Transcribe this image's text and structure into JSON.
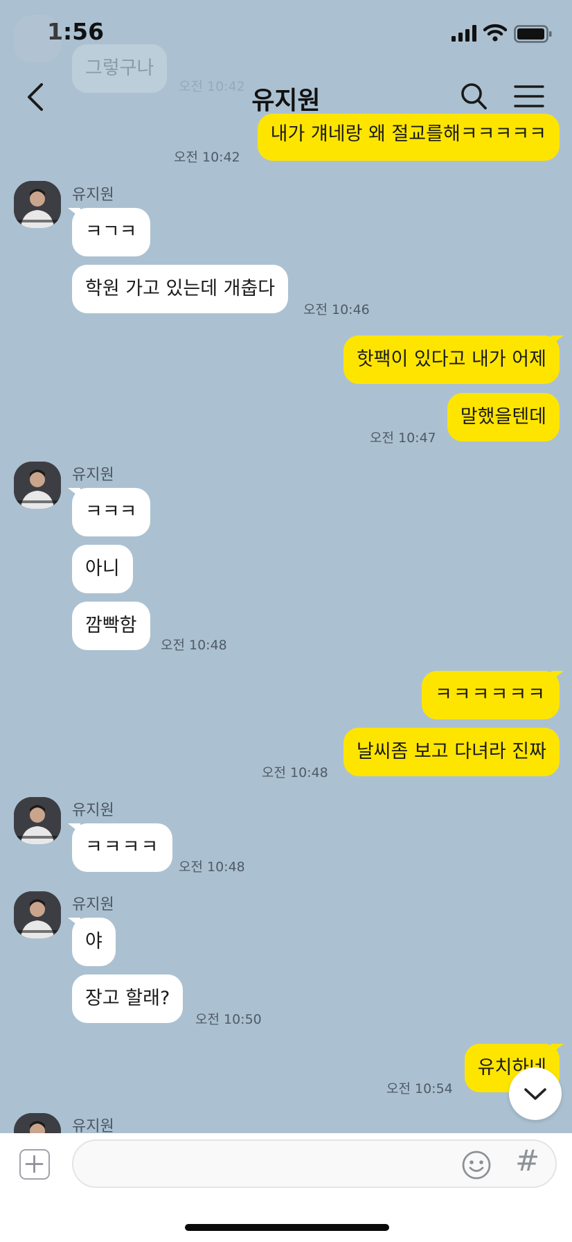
{
  "status_bar": {
    "time": "1:56"
  },
  "header": {
    "title": "유지원"
  },
  "faded_preview": {
    "text": "그렇구나",
    "time": "오전 10:42"
  },
  "messages": [
    {
      "text": "내가 걔네랑 왜 절교를해ㅋㅋㅋㅋㅋ",
      "time": "오전 10:42"
    },
    {
      "sender": "유지원",
      "text": "ㅋㄱㅋ"
    },
    {
      "text": "학원 가고 있는데 개춥다",
      "time": "오전 10:46"
    },
    {
      "text": "핫팩이 있다고 내가 어제"
    },
    {
      "text": "말했을텐데",
      "time": "오전 10:47"
    },
    {
      "sender": "유지원",
      "text": "ㅋㅋㅋ"
    },
    {
      "text": "아니"
    },
    {
      "text": "깜빡함",
      "time": "오전 10:48"
    },
    {
      "text": "ㅋㅋㅋㅋㅋㅋ"
    },
    {
      "text": "날씨좀 보고 다녀라 진짜",
      "time": "오전 10:48"
    },
    {
      "sender": "유지원",
      "text": "ㅋㅋㅋㅋ",
      "time": "오전 10:48"
    },
    {
      "sender": "유지원",
      "text": "야"
    },
    {
      "text": "장고 할래?",
      "time": "오전 10:50"
    },
    {
      "text": "유치하네",
      "time": "오전 10:54"
    },
    {
      "sender": "유지원"
    }
  ],
  "input": {
    "placeholder": "",
    "hash_label": "#"
  },
  "colors": {
    "background": "#abc1d1",
    "outgoing": "#fee500",
    "incoming": "#ffffff"
  }
}
